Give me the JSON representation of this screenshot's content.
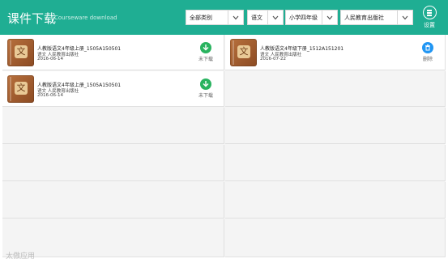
{
  "header": {
    "title": "课件下载",
    "subtitle": "Courseware download",
    "filters": [
      {
        "value": "全部类别"
      },
      {
        "value": "语文"
      },
      {
        "value": "小学四年级"
      },
      {
        "value": "人民教育出版社"
      }
    ],
    "settings_label": "设置"
  },
  "items": [
    {
      "cover_char": "文",
      "name": "人教版语文4年级上册_1505A150501",
      "subject": "语文",
      "publisher": "人民教育出版社",
      "date": "2016-06-14",
      "action": "未下载",
      "action_icon": "download-icon"
    },
    {
      "cover_char": "文",
      "name": "人教版语文4年级下册_1512A151201",
      "subject": "语文",
      "publisher": "人民教育出版社",
      "date": "2016-07-22",
      "action": "删除",
      "action_icon": "trash-icon"
    },
    {
      "cover_char": "文",
      "name": "人教版语文4年级上册_1505A150501",
      "subject": "语文",
      "publisher": "人民教育出版社",
      "date": "2016-06-14",
      "action": "未下载",
      "action_icon": "download-icon"
    }
  ],
  "watermark": "太傲应用",
  "colors": {
    "header_bg": "#1fae93",
    "download_green": "#29b35f",
    "delete_blue": "#2196f3"
  }
}
